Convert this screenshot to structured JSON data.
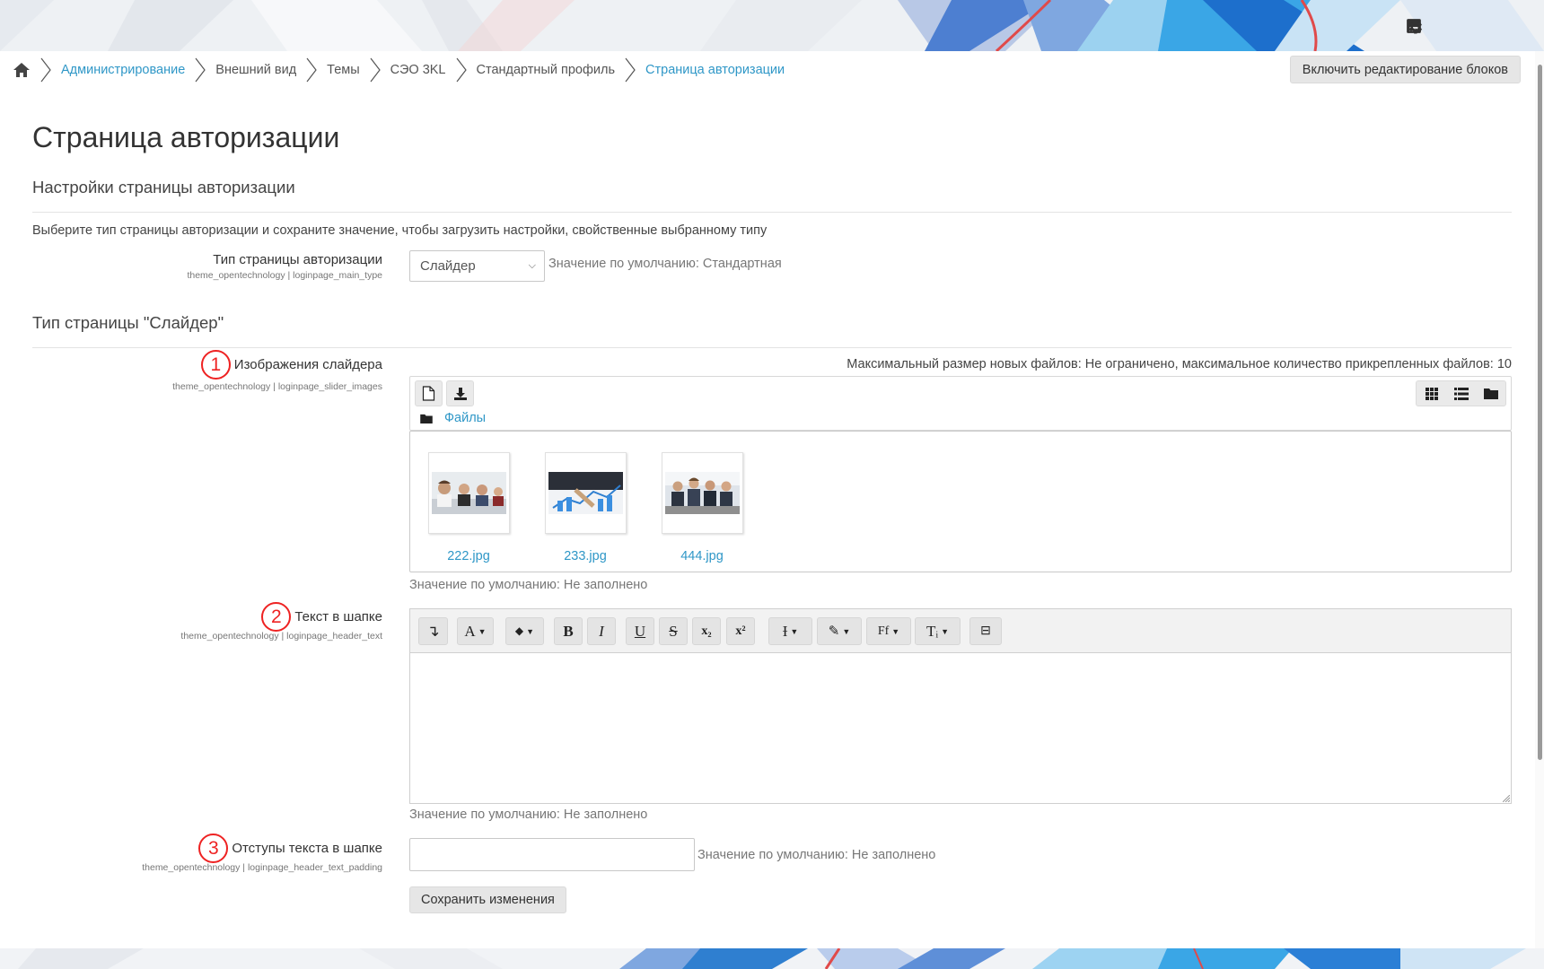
{
  "header": {
    "icons": [
      "paper-plane-icon",
      "save-icon",
      "gear-icon"
    ]
  },
  "breadcrumb": {
    "items": [
      {
        "label": "Администрирование",
        "link": true
      },
      {
        "label": "Внешний вид",
        "link": false
      },
      {
        "label": "Темы",
        "link": false
      },
      {
        "label": "СЭО 3KL",
        "link": false
      },
      {
        "label": "Стандартный профиль",
        "link": false
      },
      {
        "label": "Страница авторизации",
        "link": true
      }
    ]
  },
  "edit_blocks_button": "Включить редактирование блоков",
  "page_title": "Страница авторизации",
  "section1": {
    "heading": "Настройки страницы авторизации",
    "description": "Выберите тип страницы авторизации и сохраните значение, чтобы загрузить настройки, свойственные выбранному типу",
    "type_label": "Тип страницы авторизации",
    "type_key": "theme_opentechnology | loginpage_main_type",
    "type_value": "Слайдер",
    "type_default": "Значение по умолчанию: Стандартная"
  },
  "section2": {
    "heading": "Тип страницы \"Слайдер\"",
    "slider_images": {
      "badge": "1",
      "label": "Изображения слайдера",
      "key": "theme_opentechnology | loginpage_slider_images",
      "max_size": "Максимальный размер новых файлов: Не ограничено, максимальное количество прикрепленных файлов: 10",
      "path": "Файлы",
      "files": [
        "222.jpg",
        "233.jpg",
        "444.jpg"
      ],
      "default": "Значение по умолчанию: Не заполнено"
    },
    "header_text": {
      "badge": "2",
      "label": "Текст в шапке",
      "key": "theme_opentechnology | loginpage_header_text",
      "toolbar": [
        "↴",
        "A",
        "◆",
        "B",
        "I",
        "U",
        "S",
        "x₂",
        "x²",
        "Ɨ",
        "✎",
        "Ff",
        "Tᵢ",
        "⊟"
      ],
      "default": "Значение по умолчанию: Не заполнено"
    },
    "header_padding": {
      "badge": "3",
      "label": "Отступы текста в шапке",
      "key": "theme_opentechnology | loginpage_header_text_padding",
      "value": "",
      "default": "Значение по умолчанию: Не заполнено"
    }
  },
  "save_button": "Сохранить изменения"
}
